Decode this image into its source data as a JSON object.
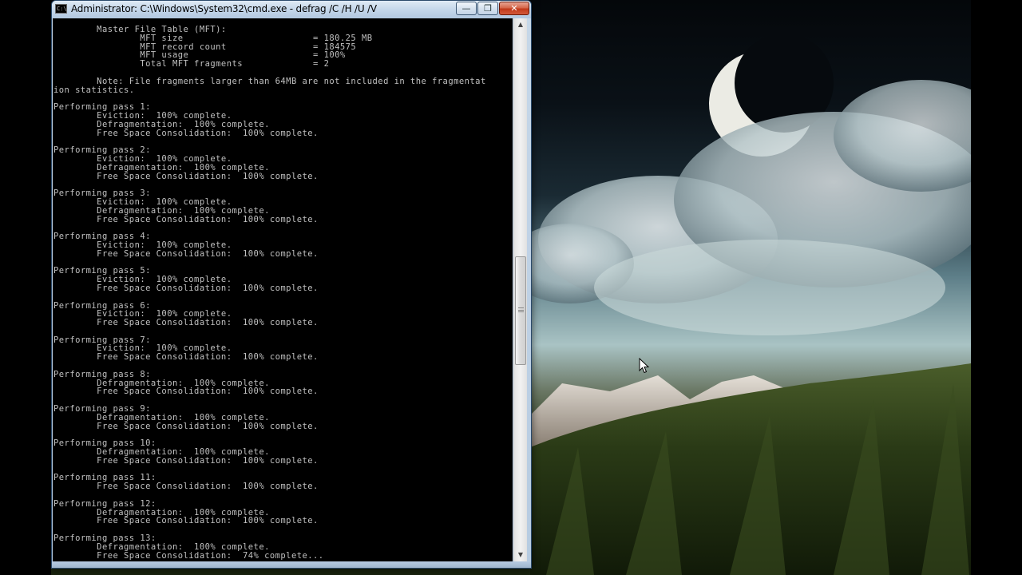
{
  "window": {
    "title": "Administrator: C:\\Windows\\System32\\cmd.exe - defrag  /C /H /U /V",
    "icon_label": "C:\\",
    "minimize_glyph": "—",
    "maximize_glyph": "❐",
    "close_glyph": "✕"
  },
  "console": {
    "lines": [
      "        Master File Table (MFT):",
      "                MFT size                        = 180.25 MB",
      "                MFT record count                = 184575",
      "                MFT usage                       = 100%",
      "                Total MFT fragments             = 2",
      "",
      "        Note: File fragments larger than 64MB are not included in the fragmentat",
      "ion statistics.",
      "",
      "Performing pass 1:",
      "        Eviction:  100% complete.",
      "        Defragmentation:  100% complete.",
      "        Free Space Consolidation:  100% complete.",
      "",
      "Performing pass 2:",
      "        Eviction:  100% complete.",
      "        Defragmentation:  100% complete.",
      "        Free Space Consolidation:  100% complete.",
      "",
      "Performing pass 3:",
      "        Eviction:  100% complete.",
      "        Defragmentation:  100% complete.",
      "        Free Space Consolidation:  100% complete.",
      "",
      "Performing pass 4:",
      "        Eviction:  100% complete.",
      "        Free Space Consolidation:  100% complete.",
      "",
      "Performing pass 5:",
      "        Eviction:  100% complete.",
      "        Free Space Consolidation:  100% complete.",
      "",
      "Performing pass 6:",
      "        Eviction:  100% complete.",
      "        Free Space Consolidation:  100% complete.",
      "",
      "Performing pass 7:",
      "        Eviction:  100% complete.",
      "        Free Space Consolidation:  100% complete.",
      "",
      "Performing pass 8:",
      "        Defragmentation:  100% complete.",
      "        Free Space Consolidation:  100% complete.",
      "",
      "Performing pass 9:",
      "        Defragmentation:  100% complete.",
      "        Free Space Consolidation:  100% complete.",
      "",
      "Performing pass 10:",
      "        Defragmentation:  100% complete.",
      "        Free Space Consolidation:  100% complete.",
      "",
      "Performing pass 11:",
      "        Free Space Consolidation:  100% complete.",
      "",
      "Performing pass 12:",
      "        Defragmentation:  100% complete.",
      "        Free Space Consolidation:  100% complete.",
      "",
      "Performing pass 13:",
      "        Defragmentation:  100% complete.",
      "        Free Space Consolidation:  74% complete..."
    ]
  },
  "colors": {
    "console_bg": "#000000",
    "console_fg": "#c0c0c0",
    "titlebar": "#c2d5e9",
    "close_button": "#c2391a"
  },
  "icons": {
    "window_icon": "cmd-icon",
    "cursor": "mouse-pointer-icon"
  }
}
